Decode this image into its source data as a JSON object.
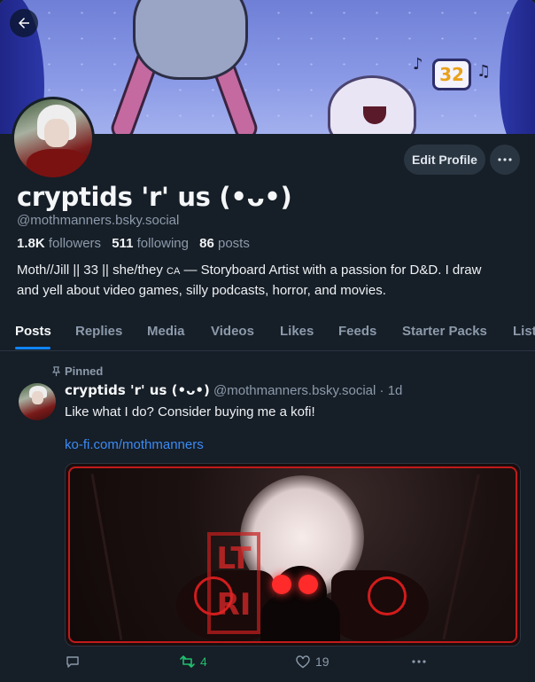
{
  "banner": {
    "dice_number": "32"
  },
  "profile": {
    "display_name": "cryptids 'r' us (•ᴗ•)",
    "handle": "@mothmanners.bsky.social",
    "edit_label": "Edit Profile",
    "stats": {
      "followers_count": "1.8K",
      "followers_label": "followers",
      "following_count": "511",
      "following_label": "following",
      "posts_count": "86",
      "posts_label": "posts"
    },
    "bio_line1_a": "Moth//Jill || 33 || she/they ",
    "bio_ca": "CA",
    "bio_line1_b": " — Storyboard Artist with a passion for D&D. I draw",
    "bio_line2": "and yell about video games, silly podcasts, horror, and movies."
  },
  "tabs": [
    {
      "label": "Posts"
    },
    {
      "label": "Replies"
    },
    {
      "label": "Media"
    },
    {
      "label": "Videos"
    },
    {
      "label": "Likes"
    },
    {
      "label": "Feeds"
    },
    {
      "label": "Starter Packs"
    },
    {
      "label": "Lists"
    }
  ],
  "post": {
    "pinned_label": "Pinned",
    "author_name": "cryptids 'r' us (•ᴗ•)",
    "author_handle": "@mothmanners.bsky.social",
    "separator": " · ",
    "time": "1d",
    "text": "Like what I do? Consider buying me a kofi!",
    "link": "ko-fi.com/mothmanners",
    "embed_stamp": "LT RI",
    "reposts": "4",
    "likes": "19"
  },
  "colors": {
    "background": "#161e27",
    "accent": "#1083fe",
    "link": "#3b8bf5",
    "repost_active": "#20bc6c",
    "muted": "#8c9aab"
  },
  "icons": [
    "back-arrow-icon",
    "ellipsis-icon",
    "pin-icon",
    "reply-icon",
    "repost-icon",
    "heart-icon",
    "more-icon"
  ]
}
